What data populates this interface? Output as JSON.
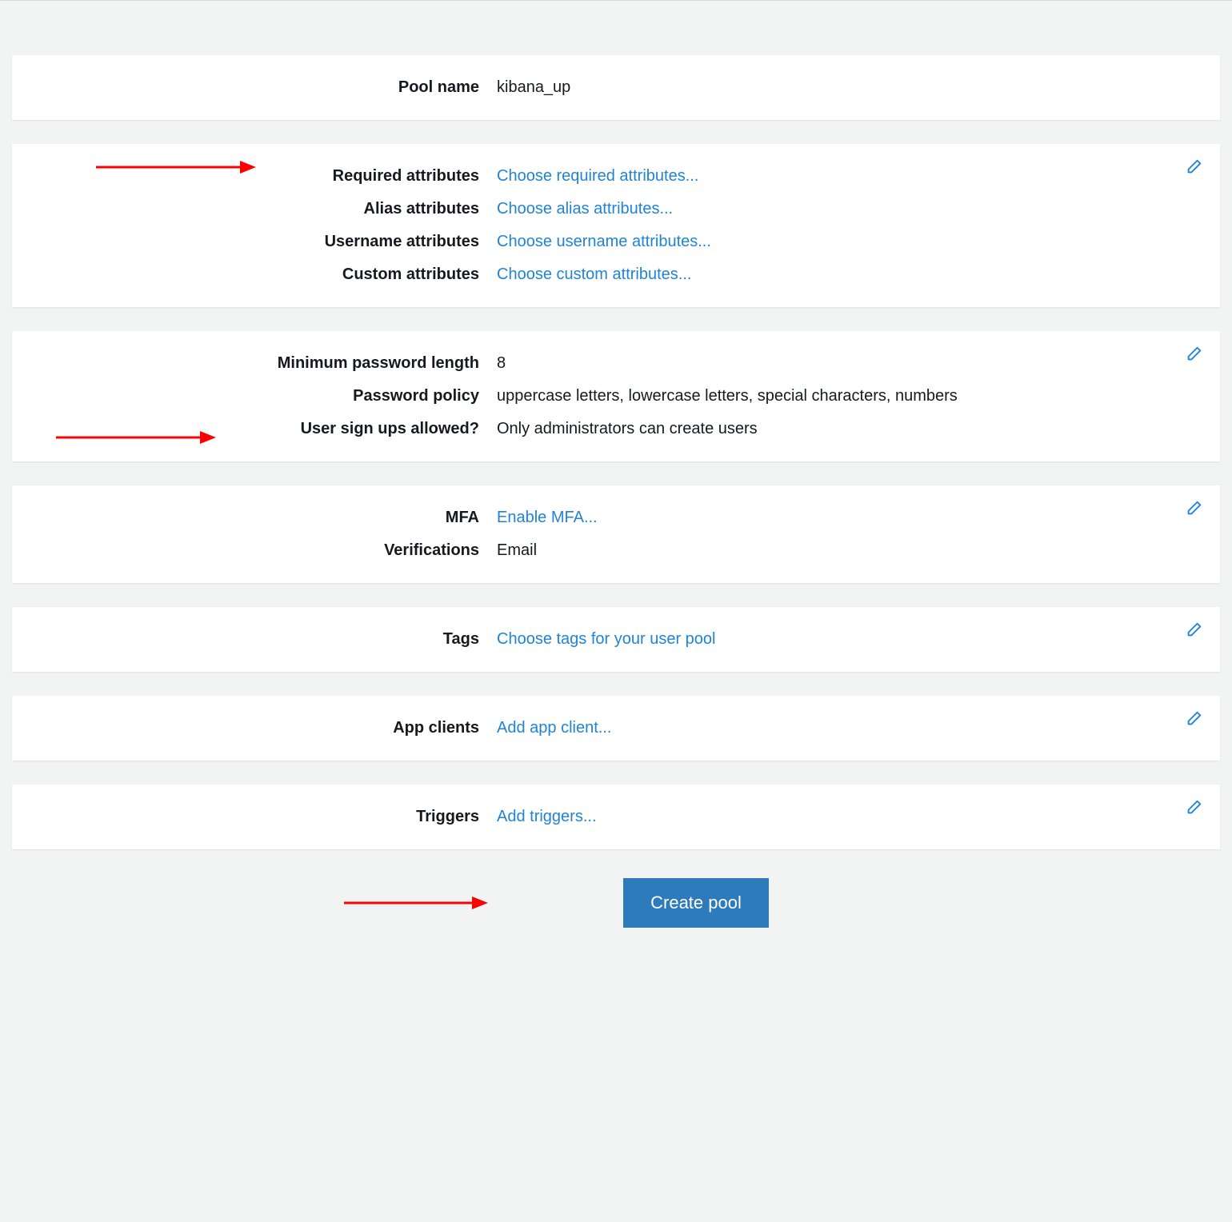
{
  "panel1": {
    "pool_name_label": "Pool name",
    "pool_name_value": "kibana_up"
  },
  "panel2": {
    "required_attributes_label": "Required attributes",
    "required_attributes_value": "Choose required attributes...",
    "alias_attributes_label": "Alias attributes",
    "alias_attributes_value": "Choose alias attributes...",
    "username_attributes_label": "Username attributes",
    "username_attributes_value": "Choose username attributes...",
    "custom_attributes_label": "Custom attributes",
    "custom_attributes_value": "Choose custom attributes..."
  },
  "panel3": {
    "min_password_label": "Minimum password length",
    "min_password_value": "8",
    "password_policy_label": "Password policy",
    "password_policy_value": "uppercase letters, lowercase letters, special characters, numbers",
    "signups_label": "User sign ups allowed?",
    "signups_value": "Only administrators can create users"
  },
  "panel4": {
    "mfa_label": "MFA",
    "mfa_value": "Enable MFA...",
    "verifications_label": "Verifications",
    "verifications_value": "Email"
  },
  "panel5": {
    "tags_label": "Tags",
    "tags_value": "Choose tags for your user pool"
  },
  "panel6": {
    "appclients_label": "App clients",
    "appclients_value": "Add app client..."
  },
  "panel7": {
    "triggers_label": "Triggers",
    "triggers_value": "Add triggers..."
  },
  "button": {
    "create_pool": "Create pool"
  }
}
